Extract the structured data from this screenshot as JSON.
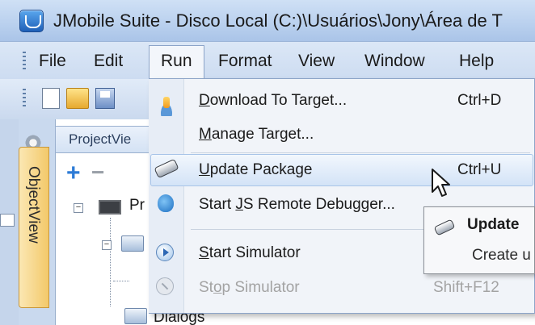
{
  "window": {
    "title": "JMobile Suite - Disco Local (C:)\\Usuários\\Jony\\Área de T"
  },
  "menubar": {
    "items": [
      "File",
      "Edit",
      "Run",
      "Format",
      "View",
      "Window",
      "Help"
    ],
    "active": "Run"
  },
  "left_tab": {
    "label": "ObjectView"
  },
  "project_panel": {
    "header": "ProjectVie",
    "tree": [
      {
        "label": "Pr"
      },
      {
        "label": "Dialogs"
      }
    ]
  },
  "run_menu": {
    "items": [
      {
        "pre": "",
        "u": "D",
        "post": "ownload To Target...",
        "shortcut": "Ctrl+D",
        "icon": "download-target-icon",
        "enabled": true
      },
      {
        "pre": "",
        "u": "M",
        "post": "anage Target...",
        "shortcut": "",
        "icon": "",
        "enabled": true
      },
      {
        "pre": "",
        "u": "U",
        "post": "pdate Package",
        "shortcut": "Ctrl+U",
        "icon": "usb-drive-icon",
        "enabled": true,
        "highlighted": true
      },
      {
        "pre": "Start ",
        "u": "J",
        "post": "S Remote Debugger...",
        "shortcut": "",
        "icon": "bug-icon",
        "enabled": true
      },
      {
        "pre": "",
        "u": "S",
        "post": "tart Simulator",
        "shortcut": "",
        "icon": "play-icon",
        "enabled": true
      },
      {
        "pre": "St",
        "u": "o",
        "post": "p Simulator",
        "shortcut": "Shift+F12",
        "icon": "stop-icon",
        "enabled": false
      }
    ]
  },
  "submenu": {
    "title": "Update",
    "line": "Create u"
  },
  "colors": {
    "menu_highlight": "#d3e3f7",
    "title_bar": "#b9d0ee",
    "object_tab": "#f3c96a",
    "disabled_text": "#a3a3a3"
  }
}
